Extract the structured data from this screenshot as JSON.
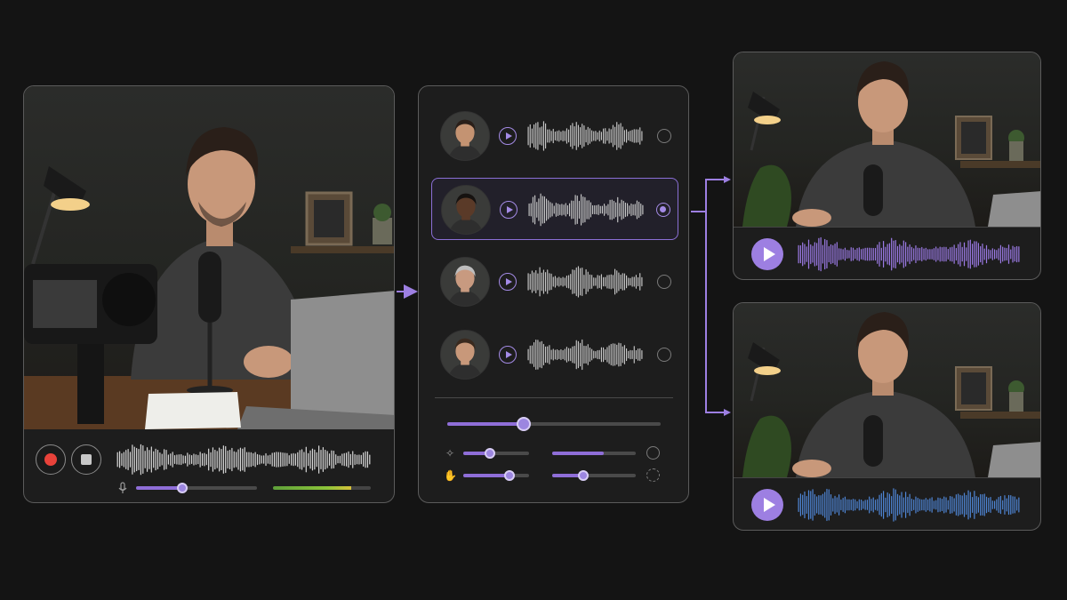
{
  "colors": {
    "background": "#141414",
    "accent": "#9d7fe2",
    "record": "#e8423a",
    "wave_input": "#d9d9d9",
    "wave_output_1": "#9c7be6",
    "wave_output_2": "#4f86d6"
  },
  "recorder": {
    "record_icon": "record-icon",
    "stop_icon": "stop-icon",
    "mic_icon": "microphone-icon",
    "mic_gain": 0.38,
    "input_level": 0.8
  },
  "voices": [
    {
      "avatar": "avatar-man-short-dark-hair",
      "selected": false
    },
    {
      "avatar": "avatar-man-dark-skin-beard",
      "selected": true
    },
    {
      "avatar": "avatar-man-gray-hair",
      "selected": false
    },
    {
      "avatar": "avatar-young-man",
      "selected": false
    }
  ],
  "controls": {
    "master": 0.36,
    "pitch_icon": "sparkle-icon",
    "pitch": 0.4,
    "pitch_right": 0.62,
    "tone_icon": "hand-icon",
    "tone": 0.7,
    "tone_right": 0.37
  },
  "outputs": [
    {
      "play_icon": "play-icon",
      "wave_color": "#9c7be6"
    },
    {
      "play_icon": "play-icon",
      "wave_color": "#4f86d6"
    }
  ]
}
